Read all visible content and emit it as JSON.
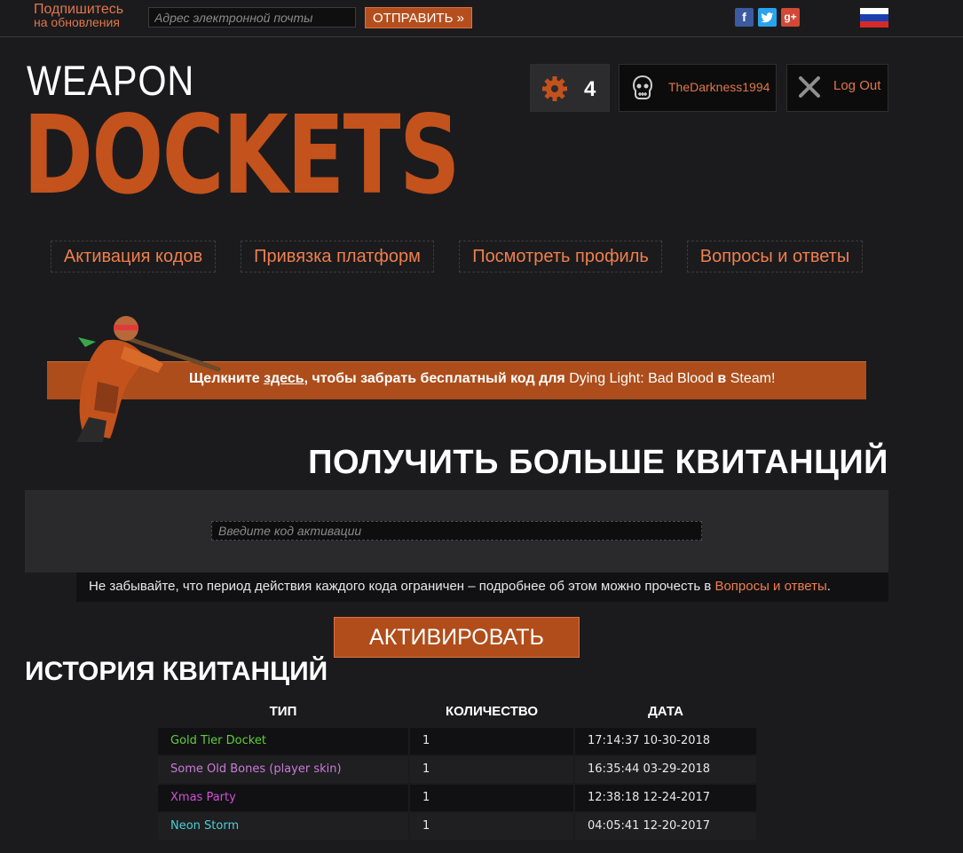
{
  "topbar": {
    "subscribe_line1": "Подпишитесь",
    "subscribe_line2": "на обновления",
    "email_placeholder": "Адрес электронной почты",
    "send_label": "ОТПРАВИТЬ »",
    "social": [
      "facebook-icon",
      "twitter-icon",
      "google-plus-icon"
    ],
    "language_flag": "russia-flag-icon"
  },
  "logo": {
    "line1": "WEAPON",
    "line2": "DOCKETS"
  },
  "user": {
    "gear_count": "4",
    "username": "TheDarkness1994",
    "logout_label": "Log Out"
  },
  "nav": [
    {
      "label": "Активация кодов"
    },
    {
      "label": "Привязка платформ"
    },
    {
      "label": "Посмотреть профиль"
    },
    {
      "label": "Вопросы и ответы"
    }
  ],
  "promo": {
    "prefix": "Щелкните ",
    "link": "здесь",
    "middle": ", чтобы забрать бесплатный код для ",
    "game": "Dying Light: Bad Blood",
    "in": " в ",
    "platform": "Steam!"
  },
  "redeem": {
    "heading": "ПОЛУЧИТЬ БОЛЬШЕ КВИТАНЦИЙ",
    "code_placeholder": "Введите код активации",
    "note_text": "Не забывайте, что период действия каждого кода ограничен – подробнее об этом можно прочесть в ",
    "note_link": "Вопросы и ответы",
    "note_end": ".",
    "activate_label": "АКТИВИРОВАТЬ"
  },
  "history": {
    "heading": "ИСТОРИЯ КВИТАНЦИЙ",
    "columns": [
      "ТИП",
      "КОЛИЧЕСТВО",
      "ДАТА"
    ],
    "rows": [
      {
        "type": "Gold Tier Docket",
        "qty": "1",
        "date": "17:14:37 10-30-2018",
        "color": "#5fcf3a"
      },
      {
        "type": "Some Old Bones (player skin)",
        "qty": "1",
        "date": "16:35:44 03-29-2018",
        "color": "#c77bd6"
      },
      {
        "type": "Xmas Party",
        "qty": "1",
        "date": "12:38:18 12-24-2017",
        "color": "#d24fd6"
      },
      {
        "type": "Neon Storm",
        "qty": "1",
        "date": "04:05:41 12-20-2017",
        "color": "#49cfd6"
      }
    ]
  },
  "colors": {
    "accent": "#c4521c",
    "link": "#ef7f4e"
  }
}
